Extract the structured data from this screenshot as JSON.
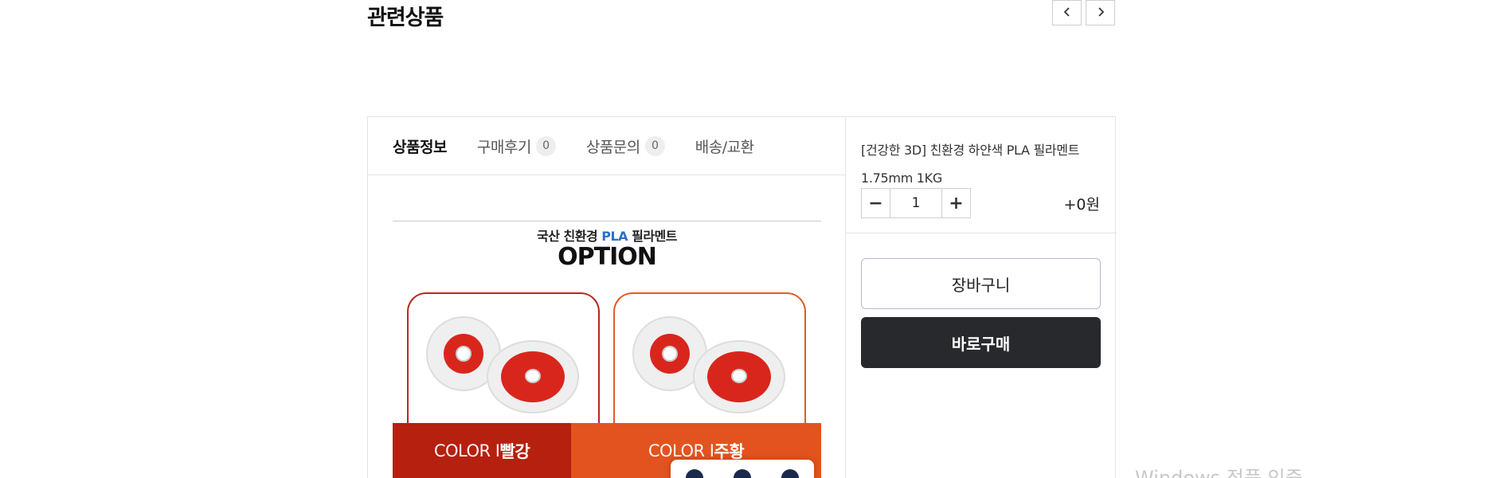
{
  "related": {
    "title": "관련상품",
    "prev_icon": "chevron-left-icon",
    "next_icon": "chevron-right-icon"
  },
  "tabs": [
    {
      "label": "상품정보",
      "count": null,
      "active": true
    },
    {
      "label": "구매후기",
      "count": "0",
      "active": false
    },
    {
      "label": "상품문의",
      "count": "0",
      "active": false
    },
    {
      "label": "배송/교환",
      "count": null,
      "active": false
    }
  ],
  "detail_image": {
    "subtitle_pre": "국산 친환경 ",
    "subtitle_pla": "PLA",
    "subtitle_post": " 필라멘트",
    "heading": "OPTION",
    "options": [
      {
        "prefix": "COLOR I ",
        "color_name": "빨강",
        "band_color": "#b5200f"
      },
      {
        "prefix": "COLOR I ",
        "color_name": "주황",
        "band_color": "#e2531f"
      }
    ]
  },
  "purchase": {
    "product_name": "[건강한 3D] 친환경 하얀색 PLA 필라멘트 1.75mm 1KG",
    "quantity": "1",
    "minus_label": "−",
    "plus_label": "+",
    "price": "+0원",
    "cart_label": "장바구니",
    "buy_label": "바로구매"
  },
  "watermark": "Windows 정품 인증"
}
